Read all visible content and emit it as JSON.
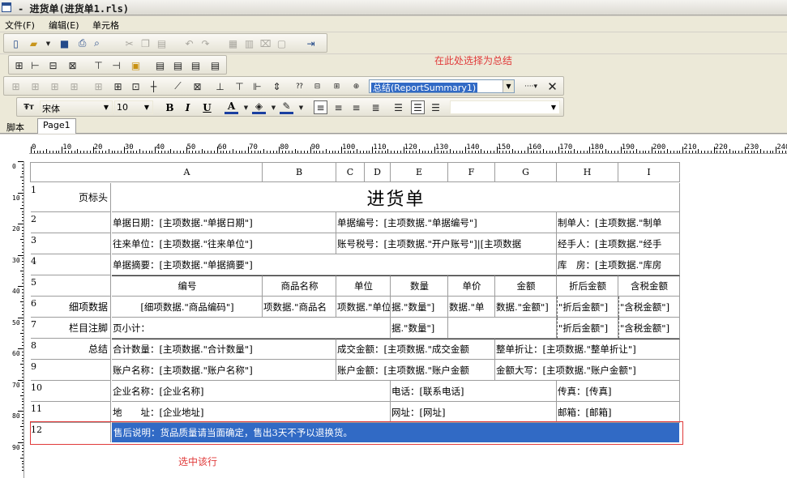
{
  "window": {
    "title": "- 进货单(进货单1.rls)"
  },
  "menu": {
    "items": [
      "文件(F)",
      "编辑(E)",
      "单元格"
    ]
  },
  "toolbar": {
    "summary_combo": "总结(ReportSummary1)",
    "font_name": "宋体",
    "font_size": "10",
    "hint": "在此处选择为总结"
  },
  "tabs": {
    "script": "脚本",
    "page": "Page1"
  },
  "ruler": {
    "h_labels": [
      "0",
      "10",
      "20",
      "30",
      "40",
      "50",
      "60",
      "70",
      "80",
      "90",
      "100",
      "110",
      "120",
      "130",
      "140",
      "150",
      "160",
      "170",
      "180",
      "190",
      "200",
      "210",
      "220",
      "230",
      "240"
    ],
    "v_labels": [
      "0",
      "10",
      "20",
      "30",
      "40",
      "50",
      "60",
      "70",
      "80",
      "90"
    ]
  },
  "sheet": {
    "columns": [
      "A",
      "B",
      "C",
      "D",
      "E",
      "F",
      "G",
      "H",
      "I"
    ],
    "row_numbers": [
      "1",
      "2",
      "3",
      "4",
      "5",
      "6",
      "7",
      "8",
      "9",
      "10",
      "11",
      "12"
    ],
    "row_labels": [
      "页标头",
      "",
      "",
      "",
      "",
      "细项数据",
      "栏目注脚",
      "总结",
      "",
      "",
      "",
      ""
    ],
    "r1": {
      "title": "进货单"
    },
    "r2": {
      "a": "单据日期：[主项数据.\"单据日期\"]",
      "c": "单据编号：[主项数据.\"单据编号\"]",
      "h": "制单人：[主项数据.\"制单"
    },
    "r3": {
      "a": "往来单位：[主项数据.\"往来单位\"]",
      "c": "账号税号：[主项数据.\"开户账号\"]|[主项数据",
      "h": "经手人：[主项数据.\"经手"
    },
    "r4": {
      "a": "单据摘要：[主项数据.\"单据摘要\"]",
      "h": "库　房：[主项数据.\"库房"
    },
    "r5": {
      "a": "编号",
      "b": "商品名称",
      "c": "单位",
      "e": "数量",
      "f": "单价",
      "g": "金额",
      "h": "折后金额",
      "i": "含税金额"
    },
    "r6": {
      "a": "[细项数据.\"商品编码\"]",
      "b": "项数据.\"商品名",
      "c": "项数据.\"单位",
      "e": "据.\"数量\"]",
      "f": "数据.\"单",
      "g": "数据.\"金额\"]",
      "h": "\"折后金额\"]",
      "i": "\"含税金额\"]"
    },
    "r7": {
      "a": "页小计：",
      "e": "据.\"数量\"]",
      "h": "\"折后金额\"]",
      "i": "\"含税金额\"]"
    },
    "r8": {
      "a": "合计数量：[主项数据.\"合计数量\"]",
      "c": "成交金额：[主项数据.\"成交金额",
      "g": "整单折让：[主项数据.\"整单折让\"]"
    },
    "r9": {
      "a": "账户名称：[主项数据.\"账户名称\"]",
      "c": "账户金额：[主项数据.\"账户金额",
      "g": "金额大写：[主项数据.\"账户金额\"]"
    },
    "r10": {
      "a": "企业名称：[企业名称]",
      "e": "电话：[联系电话]",
      "h": "传真：[传真]"
    },
    "r11": {
      "a": "地　　址：[企业地址]",
      "e": "网址：[网址]",
      "h": "邮箱：[邮箱]"
    },
    "r12": {
      "a": "售后说明：货品质量请当面确定，售出3天不予以退换货。"
    },
    "select_hint": "选中该行"
  }
}
